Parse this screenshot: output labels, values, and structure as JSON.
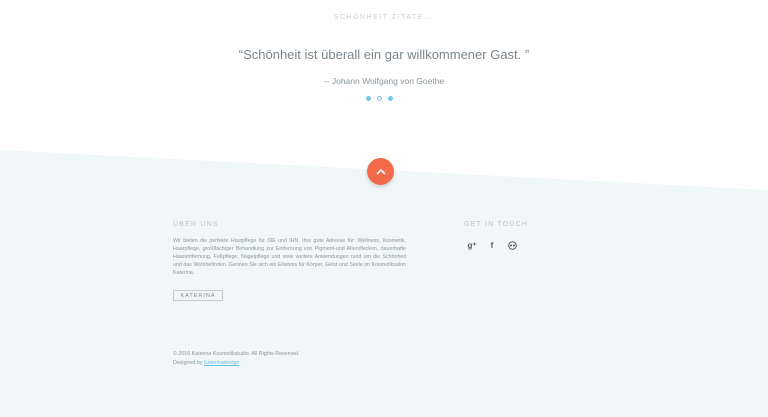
{
  "quotes": {
    "heading": "SCHÖNHEIT ZITATE...",
    "quote": "“Schönheit ist überall ein gar willkommener Gast. ”",
    "author": "-- Johann Wolfgang von Goethe",
    "dots_count": 3,
    "active_dot": 0
  },
  "colors": {
    "accent": "#f26a4a",
    "dots": "#7cc3e4",
    "footer_bg": "#f0f7f8",
    "link": "#6bc0e5"
  },
  "footer": {
    "scroll_top_icon": "chevron-up-icon",
    "about": {
      "title": "ÜBER UNS",
      "text": "Wir bieten die perfekte Hautpflege für SIE und IHN. Ihre gute Adresse für: Wellness, Kosmetik, Haarpflege, großflächiger Behandlung zur Entfernung von Pigment-und Altersflecken, dauerhafte Haarentfernung, Fußpflege, Nagelpflege und viele weitere Anwendungen rund um die Schönheit und das Wohlbefinden. Gennen Sie sich ein Erlebnis für Körper, Geist und Seele im Kosmetiksalon Katerina.",
      "button": "KATERINA"
    },
    "contact": {
      "title": "GET IN TOUCH",
      "icons": [
        "google-plus-icon",
        "facebook-icon",
        "tripadvisor-icon"
      ]
    },
    "copyright": "© 2016 Katerina Kosmetikstudio. All Rights Reserved.",
    "designed_prefix": "Designed by",
    "designed_link": "Katerinadesign"
  }
}
